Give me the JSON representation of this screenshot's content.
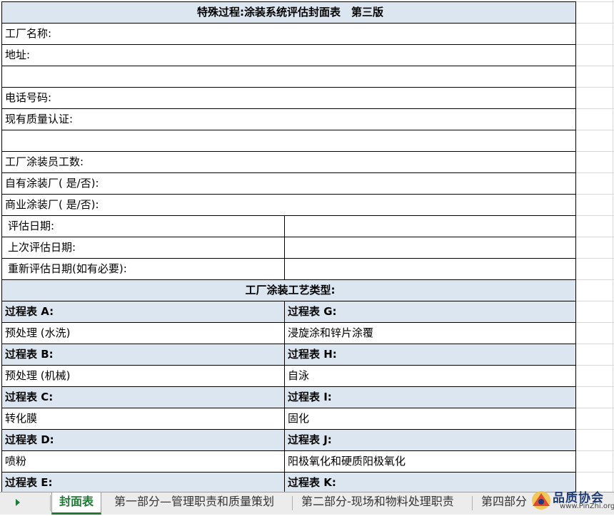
{
  "form": {
    "title": "特殊过程:涂装系统评估封面表　第三版",
    "fields": {
      "factory_name": "工厂名称:",
      "address": "地址:",
      "address_extra": "",
      "phone": "电话号码:",
      "quality_cert": "现有质量认证:",
      "quality_cert_extra": "",
      "painters_count": "工厂涂装员工数:",
      "captive_coater": "自有涂装厂( 是/否):",
      "commercial_coater": "商业涂装厂( 是/否):",
      "assess_date": "评估日期:",
      "last_assess_date": "上次评估日期:",
      "reassess_date": "重新评估日期(如有必要):"
    },
    "process_types_header": "工厂涂装工艺类型:",
    "process_tables": [
      {
        "left_label": "过程表 A:",
        "left_value": "预处理 (水洗)",
        "right_label": "过程表 G:",
        "right_value": "浸旋涂和锌片涂覆"
      },
      {
        "left_label": "过程表 B:",
        "left_value": "预处理 (机械)",
        "right_label": "过程表 H:",
        "right_value": "自泳"
      },
      {
        "left_label": "过程表 C:",
        "left_value": "转化膜",
        "right_label": "过程表 I:",
        "right_value": "固化"
      },
      {
        "left_label": "过程表 D:",
        "left_value": "喷粉",
        "right_label": "过程表 J:",
        "right_value": "阳极氧化和硬质阳极氧化"
      },
      {
        "left_label": "过程表 E:",
        "left_value": "",
        "right_label": "过程表 K:",
        "right_value": ""
      }
    ]
  },
  "tabs": [
    {
      "label": "封面表",
      "active": true
    },
    {
      "label": "第一部分—管理职责和质量策划",
      "active": false
    },
    {
      "label": "第二部分-现场和物料处理职责",
      "active": false
    },
    {
      "label": "第四部分",
      "active": false
    }
  ],
  "watermark": {
    "text": "品质协会",
    "url": "www.PinZhi.org"
  },
  "colors": {
    "header_fill": "#dce6f1",
    "active_tab": "#1e7b34"
  }
}
